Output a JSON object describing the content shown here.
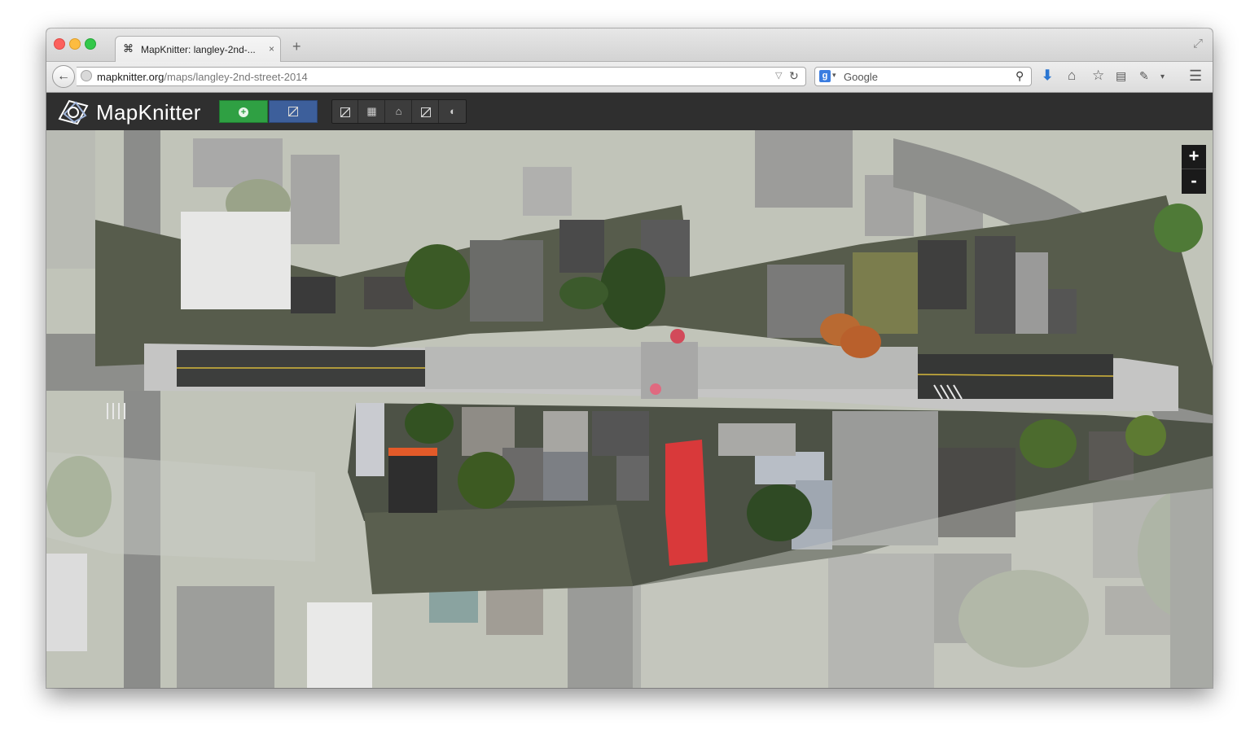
{
  "browser": {
    "tab": {
      "title": "MapKnitter: langley-2nd-...",
      "favicon": "mapknitter-favicon",
      "close_glyph": "×"
    },
    "new_tab_glyph": "+",
    "url": {
      "host": "mapknitter.org",
      "path": "/maps/langley-2nd-street-2014"
    },
    "search": {
      "engine": "g",
      "placeholder": "Google"
    },
    "icons": [
      "back-icon",
      "reload-icon",
      "search-icon",
      "download-icon",
      "home-icon",
      "bookmark-star-icon",
      "reader-icon",
      "extension-icon",
      "menu-icon"
    ]
  },
  "app": {
    "logo_text": "MapKnitter",
    "add_button_glyph": "+",
    "tools": [
      "layer-image-icon",
      "stack-icon",
      "home-icon",
      "image-edit-icon",
      "sphere-icon"
    ]
  },
  "map": {
    "zoom_in": "+",
    "zoom_out": "-"
  },
  "colors": {
    "header_bg": "#2f2f2f",
    "add_button": "#2fa043",
    "image_button": "#3d5f9b",
    "roof_red": "#d9393a"
  }
}
